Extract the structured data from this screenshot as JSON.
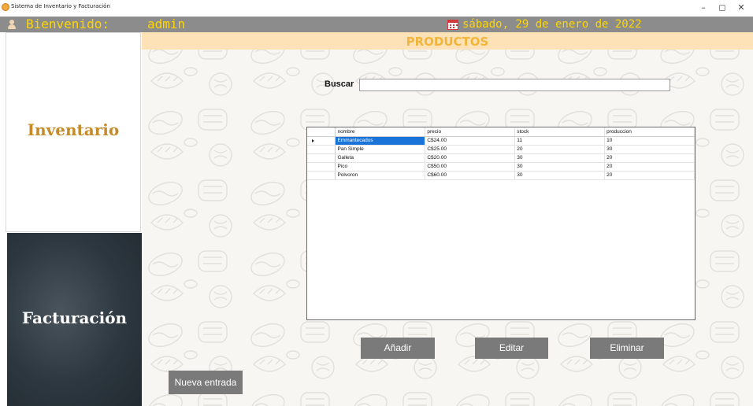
{
  "window": {
    "title": "Sistema de Inventario y Facturación",
    "minimize": "–",
    "maximize": "◻",
    "close": "✕"
  },
  "header": {
    "welcome": "Bienvenido:",
    "username": "admin",
    "date": "sábado, 29 de enero de 2022",
    "text_color": "#ffd600",
    "bar_color": "#8c8c8c"
  },
  "sidebar": {
    "items": [
      {
        "label": "Inventario",
        "color": "#c58b2a"
      },
      {
        "label": "Facturación",
        "color": "#ffffff"
      }
    ]
  },
  "main": {
    "title": "PRODUCTOS",
    "search": {
      "label": "Buscar",
      "value": ""
    },
    "grid": {
      "columns": [
        "nombre",
        "precio",
        "stock",
        "produccion"
      ],
      "rows": [
        [
          "Emmantecados",
          "C$24.00",
          "11",
          "10"
        ],
        [
          "Pan Simple",
          "C$25.00",
          "20",
          "30"
        ],
        [
          "Galleta",
          "C$20.00",
          "30",
          "20"
        ],
        [
          "Pico",
          "C$50.00",
          "30",
          "20"
        ],
        [
          "Polvoron",
          "C$60.00",
          "30",
          "20"
        ]
      ],
      "selected_row": 0
    },
    "buttons": {
      "add": "Añadir",
      "edit": "Editar",
      "delete": "Eliminar",
      "new_entry": "Nueva entrada"
    }
  }
}
